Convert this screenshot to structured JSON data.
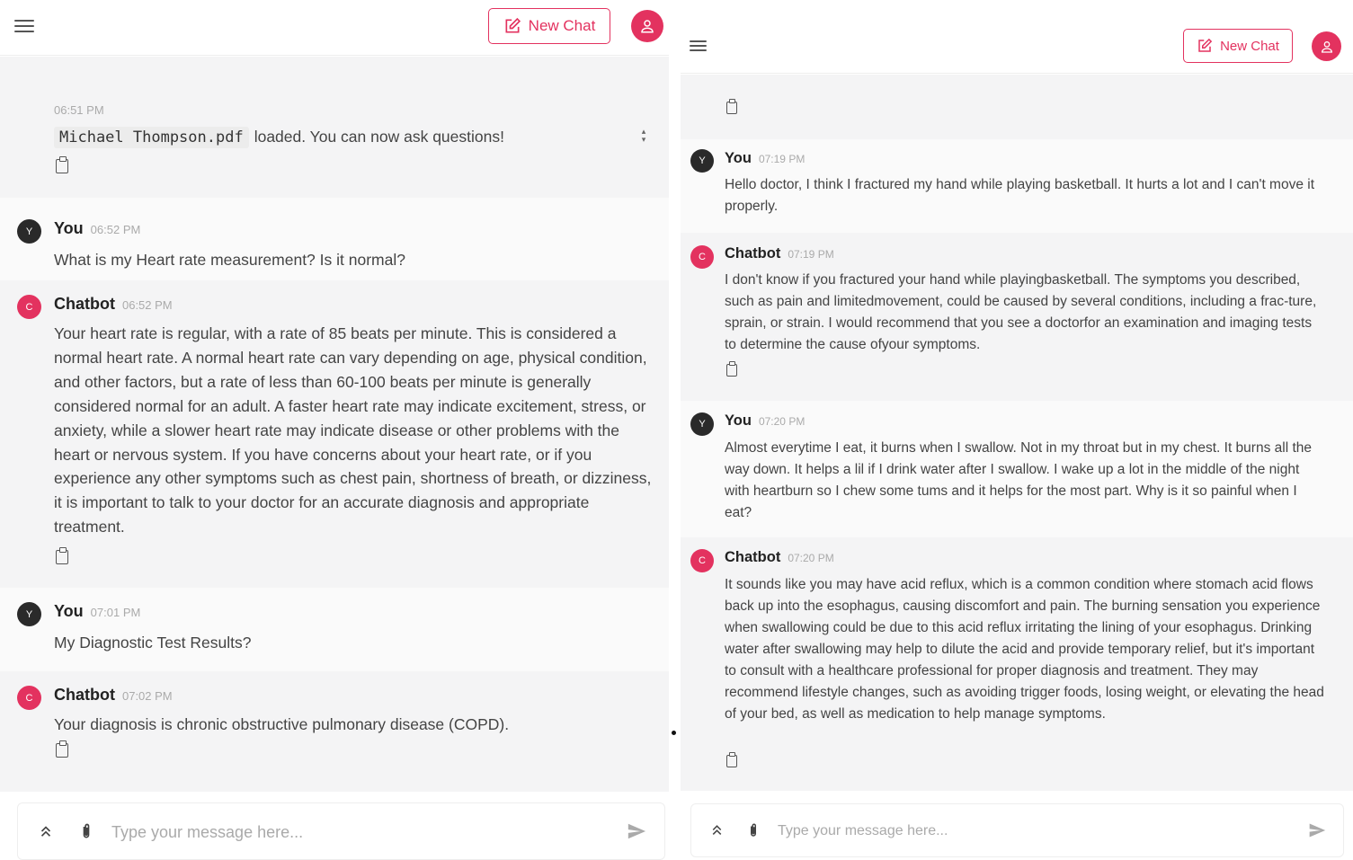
{
  "left": {
    "header": {
      "new_chat_label": "New Chat"
    },
    "intro": {
      "time": "06:51 PM",
      "filename": "Michael Thompson.pdf",
      "text": "loaded. You can now ask questions!"
    },
    "messages": [
      {
        "sender": "You",
        "initial": "Y",
        "time": "06:52 PM",
        "text": "What is my Heart rate measurement? Is it normal?"
      },
      {
        "sender": "Chatbot",
        "initial": "C",
        "time": "06:52 PM",
        "text": "Your heart rate is regular, with a rate of 85 beats per minute. This is considered a normal heart rate. A normal heart rate can vary depending on age, physical condition, and other factors, but a rate of less than 60-100 beats per minute is generally considered normal for an adult. A faster heart rate may indicate excitement, stress, or anxiety, while a slower heart rate may indicate disease or other problems with the heart or nervous system. If you have concerns about your heart rate, or if you experience any other symptoms such as chest pain, shortness of breath, or dizziness, it is important to talk to your doctor for an accurate diagnosis and appropriate treatment."
      },
      {
        "sender": "You",
        "initial": "Y",
        "time": "07:01 PM",
        "text": "My Diagnostic Test Results?"
      },
      {
        "sender": "Chatbot",
        "initial": "C",
        "time": "07:02 PM",
        "text": "Your diagnosis is chronic obstructive pulmonary disease (COPD)."
      }
    ],
    "input": {
      "placeholder": "Type your message here..."
    }
  },
  "right": {
    "header": {
      "new_chat_label": "New Chat"
    },
    "messages": [
      {
        "sender": "You",
        "initial": "Y",
        "time": "07:19 PM",
        "text": "Hello doctor, I think I fractured my hand while playing basketball. It hurts a lot and I can't move it properly."
      },
      {
        "sender": "Chatbot",
        "initial": "C",
        "time": "07:19 PM",
        "text": "I don't know if you fractured your hand while playingbasketball. The symptoms you described, such as pain and limitedmovement, could be caused by several conditions, including a frac-ture, sprain, or strain. I would recommend that you see a doctorfor an examination and imaging tests to determine the cause ofyour symptoms."
      },
      {
        "sender": "You",
        "initial": "Y",
        "time": "07:20 PM",
        "text": "Almost everytime I eat, it burns when I swallow. Not in my throat but in my chest. It burns all the way down. It helps a lil if I drink water after I swallow. I wake up a lot in the middle of the night with heartburn so I chew some tums and it helps for the most part. Why is it so painful when I eat?"
      },
      {
        "sender": "Chatbot",
        "initial": "C",
        "time": "07:20 PM",
        "text": "It sounds like you may have acid reflux, which is a common condition where stomach acid flows back up into the esophagus, causing discomfort and pain. The burning sensation you experience when swallowing could be due to this acid reflux irritating the lining of your esophagus. Drinking water after swallowing may help to dilute the acid and provide temporary relief, but it's important to consult with a healthcare professional for proper diagnosis and treatment. They may recommend lifestyle changes, such as avoiding trigger foods, losing weight, or elevating the head of your bed, as well as medication to help manage symptoms."
      }
    ],
    "input": {
      "placeholder": "Type your message here..."
    }
  }
}
